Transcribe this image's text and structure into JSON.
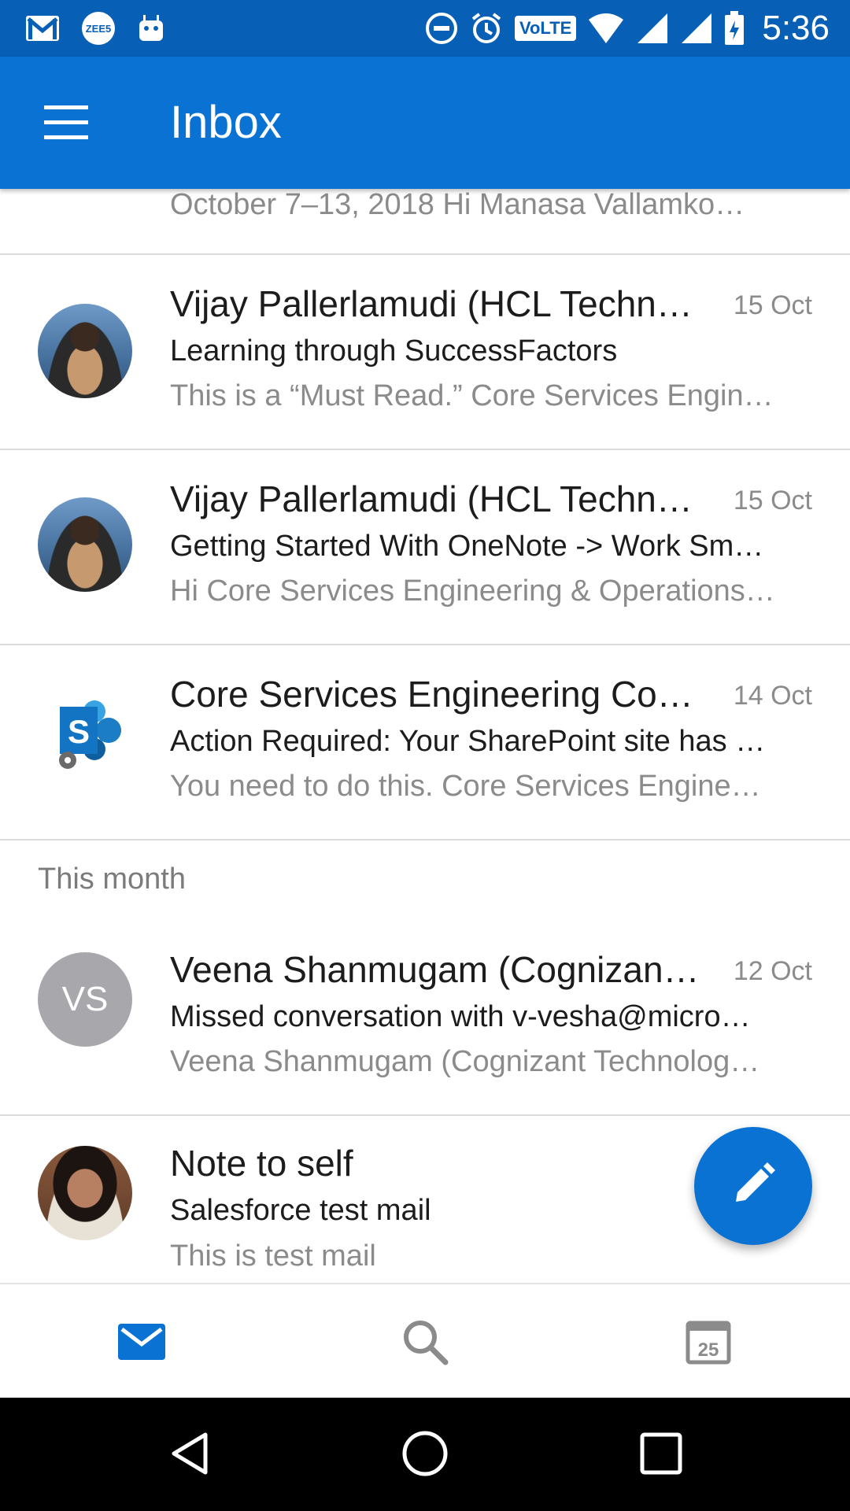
{
  "status_bar": {
    "time": "5:36",
    "volte": "VoLTE",
    "zee5": "ZEE5",
    "icons": [
      "gmail-icon",
      "zee5-icon",
      "android-icon",
      "do-not-disturb-icon",
      "alarm-icon",
      "volte-icon",
      "wifi-icon",
      "signal-icon",
      "signal-icon",
      "battery-icon"
    ]
  },
  "app_bar": {
    "title": "Inbox",
    "menu_icon": "hamburger-menu-icon"
  },
  "partial_row": {
    "preview": "October 7–13, 2018 Hi Manasa Vallamko…"
  },
  "messages": [
    {
      "sender": "Vijay Pallerlamudi (HCL Techn…",
      "date": "15 Oct",
      "subject": "Learning through SuccessFactors",
      "snippet": "This is a “Must Read.” Core Services Engin…",
      "avatar": "photo"
    },
    {
      "sender": "Vijay Pallerlamudi (HCL Techn…",
      "date": "15 Oct",
      "subject": "Getting Started With OneNote -> Work Sm…",
      "snippet": "Hi Core Services Engineering & Operations…",
      "avatar": "photo"
    },
    {
      "sender": "Core Services Engineering Co…",
      "date": "14 Oct",
      "subject": "Action Required: Your SharePoint site has …",
      "snippet": "You need to do this. Core Services Engine…",
      "avatar": "sharepoint-logo"
    },
    {
      "sender": "Veena Shanmugam (Cognizan…",
      "date": "12 Oct",
      "subject": "Missed conversation with v-vesha@micro…",
      "snippet": "Veena Shanmugam (Cognizant Technolog…",
      "avatar": "initials",
      "initials": "VS"
    },
    {
      "sender": "Note to self",
      "date": "",
      "subject": "Salesforce test mail",
      "snippet": "This is test mail",
      "avatar": "photo"
    }
  ],
  "section_header": "This month",
  "fab": {
    "icon": "pencil-compose-icon"
  },
  "bottom_nav": {
    "items": [
      {
        "icon": "mail-icon",
        "active": true
      },
      {
        "icon": "search-icon",
        "active": false
      },
      {
        "icon": "calendar-icon",
        "active": false,
        "badge": "25"
      }
    ]
  },
  "system_nav": {
    "items": [
      "back-icon",
      "home-icon",
      "recents-icon"
    ]
  },
  "colors": {
    "primary": "#0a72d3",
    "status_bar": "#075fb6",
    "secondary_text": "#8b8b8b"
  }
}
